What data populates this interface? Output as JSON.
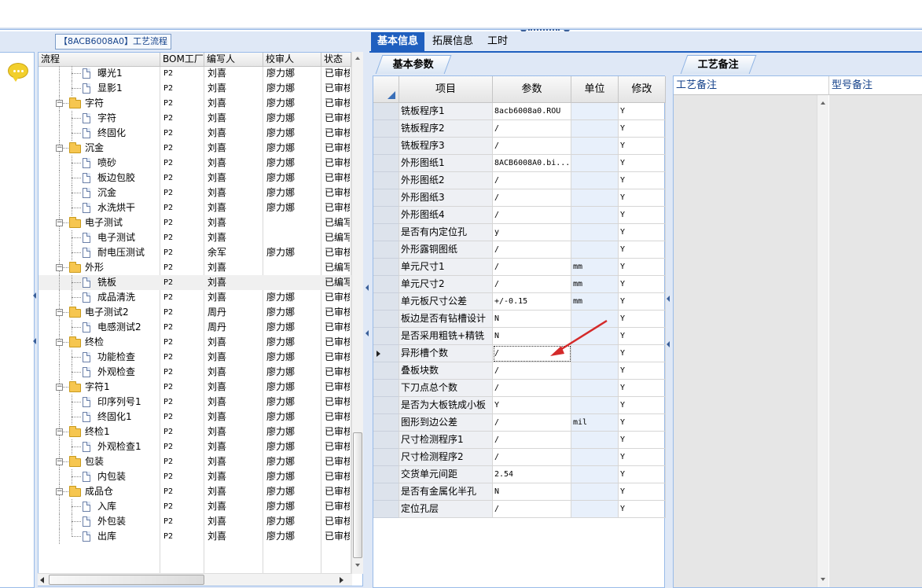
{
  "process_panel": {
    "title": "【8ACB6008A0】工艺流程",
    "columns": [
      "流程",
      "BOM工厂",
      "编写人",
      "校审人",
      "状态"
    ],
    "rows": [
      {
        "level": 2,
        "kind": "doc",
        "name": "曝光1",
        "bom": "P2",
        "author": "刘喜",
        "reviewer": "廖力娜",
        "status": "已审核"
      },
      {
        "level": 2,
        "kind": "doc",
        "name": "显影1",
        "bom": "P2",
        "author": "刘喜",
        "reviewer": "廖力娜",
        "status": "已审核"
      },
      {
        "level": 1,
        "kind": "folder",
        "name": "字符",
        "bom": "P2",
        "author": "刘喜",
        "reviewer": "廖力娜",
        "status": "已审核"
      },
      {
        "level": 2,
        "kind": "doc",
        "name": "字符",
        "bom": "P2",
        "author": "刘喜",
        "reviewer": "廖力娜",
        "status": "已审核"
      },
      {
        "level": 2,
        "kind": "doc",
        "name": "终固化",
        "bom": "P2",
        "author": "刘喜",
        "reviewer": "廖力娜",
        "status": "已审核"
      },
      {
        "level": 1,
        "kind": "folder",
        "name": "沉金",
        "bom": "P2",
        "author": "刘喜",
        "reviewer": "廖力娜",
        "status": "已审核"
      },
      {
        "level": 2,
        "kind": "doc",
        "name": "喷砂",
        "bom": "P2",
        "author": "刘喜",
        "reviewer": "廖力娜",
        "status": "已审核"
      },
      {
        "level": 2,
        "kind": "doc",
        "name": "板边包胶",
        "bom": "P2",
        "author": "刘喜",
        "reviewer": "廖力娜",
        "status": "已审核"
      },
      {
        "level": 2,
        "kind": "doc",
        "name": "沉金",
        "bom": "P2",
        "author": "刘喜",
        "reviewer": "廖力娜",
        "status": "已审核"
      },
      {
        "level": 2,
        "kind": "doc",
        "name": "水洗烘干",
        "bom": "P2",
        "author": "刘喜",
        "reviewer": "廖力娜",
        "status": "已审核"
      },
      {
        "level": 1,
        "kind": "folder",
        "name": "电子测试",
        "bom": "P2",
        "author": "刘喜",
        "reviewer": "",
        "status": "已编写"
      },
      {
        "level": 2,
        "kind": "doc",
        "name": "电子测试",
        "bom": "P2",
        "author": "刘喜",
        "reviewer": "",
        "status": "已编写"
      },
      {
        "level": 2,
        "kind": "doc",
        "name": "耐电压测试",
        "bom": "P2",
        "author": "余军",
        "reviewer": "廖力娜",
        "status": "已审核"
      },
      {
        "level": 1,
        "kind": "folder",
        "name": "外形",
        "bom": "P2",
        "author": "刘喜",
        "reviewer": "",
        "status": "已编写"
      },
      {
        "level": 2,
        "kind": "doc",
        "name": "铣板",
        "bom": "P2",
        "author": "刘喜",
        "reviewer": "",
        "status": "已编写",
        "selected": true
      },
      {
        "level": 2,
        "kind": "doc",
        "name": "成品清洗",
        "bom": "P2",
        "author": "刘喜",
        "reviewer": "廖力娜",
        "status": "已审核"
      },
      {
        "level": 1,
        "kind": "folder",
        "name": "电子测试2",
        "bom": "P2",
        "author": "周丹",
        "reviewer": "廖力娜",
        "status": "已审核"
      },
      {
        "level": 2,
        "kind": "doc",
        "name": "电感测试2",
        "bom": "P2",
        "author": "周丹",
        "reviewer": "廖力娜",
        "status": "已审核"
      },
      {
        "level": 1,
        "kind": "folder",
        "name": "终检",
        "bom": "P2",
        "author": "刘喜",
        "reviewer": "廖力娜",
        "status": "已审核"
      },
      {
        "level": 2,
        "kind": "doc",
        "name": "功能检查",
        "bom": "P2",
        "author": "刘喜",
        "reviewer": "廖力娜",
        "status": "已审核"
      },
      {
        "level": 2,
        "kind": "doc",
        "name": "外观检查",
        "bom": "P2",
        "author": "刘喜",
        "reviewer": "廖力娜",
        "status": "已审核"
      },
      {
        "level": 1,
        "kind": "folder",
        "name": "字符1",
        "bom": "P2",
        "author": "刘喜",
        "reviewer": "廖力娜",
        "status": "已审核"
      },
      {
        "level": 2,
        "kind": "doc",
        "name": "印序列号1",
        "bom": "P2",
        "author": "刘喜",
        "reviewer": "廖力娜",
        "status": "已审核"
      },
      {
        "level": 2,
        "kind": "doc",
        "name": "终固化1",
        "bom": "P2",
        "author": "刘喜",
        "reviewer": "廖力娜",
        "status": "已审核"
      },
      {
        "level": 1,
        "kind": "folder",
        "name": "终检1",
        "bom": "P2",
        "author": "刘喜",
        "reviewer": "廖力娜",
        "status": "已审核"
      },
      {
        "level": 2,
        "kind": "doc",
        "name": "外观检查1",
        "bom": "P2",
        "author": "刘喜",
        "reviewer": "廖力娜",
        "status": "已审核"
      },
      {
        "level": 1,
        "kind": "folder",
        "name": "包装",
        "bom": "P2",
        "author": "刘喜",
        "reviewer": "廖力娜",
        "status": "已审核"
      },
      {
        "level": 2,
        "kind": "doc",
        "name": "内包装",
        "bom": "P2",
        "author": "刘喜",
        "reviewer": "廖力娜",
        "status": "已审核"
      },
      {
        "level": 1,
        "kind": "folder",
        "name": "成品仓",
        "bom": "P2",
        "author": "刘喜",
        "reviewer": "廖力娜",
        "status": "已审核"
      },
      {
        "level": 2,
        "kind": "doc",
        "name": "入库",
        "bom": "P2",
        "author": "刘喜",
        "reviewer": "廖力娜",
        "status": "已审核"
      },
      {
        "level": 2,
        "kind": "doc",
        "name": "外包装",
        "bom": "P2",
        "author": "刘喜",
        "reviewer": "廖力娜",
        "status": "已审核"
      },
      {
        "level": 2,
        "kind": "doc",
        "name": "出库",
        "bom": "P2",
        "author": "刘喜",
        "reviewer": "廖力娜",
        "status": "已审核"
      }
    ]
  },
  "tabs": [
    "基本信息",
    "拓展信息",
    "工时"
  ],
  "active_tab": 0,
  "param_tab": "基本参数",
  "remark_tab": "工艺备注",
  "param_grid": {
    "columns": [
      "项目",
      "参数",
      "单位",
      "修改"
    ],
    "current_row": 14,
    "rows": [
      {
        "item": "铣板程序1",
        "param": "8acb6008a0.ROU",
        "unit": "",
        "mod": "Y"
      },
      {
        "item": "铣板程序2",
        "param": "/",
        "unit": "",
        "mod": "Y"
      },
      {
        "item": "铣板程序3",
        "param": "/",
        "unit": "",
        "mod": "Y"
      },
      {
        "item": "外形图纸1",
        "param": "8ACB6008A0.bi...",
        "unit": "",
        "mod": "Y"
      },
      {
        "item": "外形图纸2",
        "param": "/",
        "unit": "",
        "mod": "Y"
      },
      {
        "item": "外形图纸3",
        "param": "/",
        "unit": "",
        "mod": "Y"
      },
      {
        "item": "外形图纸4",
        "param": "/",
        "unit": "",
        "mod": "Y"
      },
      {
        "item": "是否有内定位孔",
        "param": "y",
        "unit": "",
        "mod": "Y"
      },
      {
        "item": "外形露铜图纸",
        "param": "/",
        "unit": "",
        "mod": "Y"
      },
      {
        "item": "单元尺寸1",
        "param": "/",
        "unit": "mm",
        "mod": "Y"
      },
      {
        "item": "单元尺寸2",
        "param": "/",
        "unit": "mm",
        "mod": "Y"
      },
      {
        "item": "单元板尺寸公差",
        "param": "+/-0.15",
        "unit": "mm",
        "mod": "Y"
      },
      {
        "item": "板边是否有钻槽设计",
        "param": "N",
        "unit": "",
        "mod": "Y"
      },
      {
        "item": "是否采用粗铣+精铣",
        "param": "N",
        "unit": "",
        "mod": "Y"
      },
      {
        "item": "异形槽个数",
        "param": "/",
        "unit": "",
        "mod": "Y"
      },
      {
        "item": "叠板块数",
        "param": "/",
        "unit": "",
        "mod": "Y"
      },
      {
        "item": "下刀点总个数",
        "param": "/",
        "unit": "",
        "mod": "Y"
      },
      {
        "item": "是否为大板铣成小板",
        "param": "Y",
        "unit": "",
        "mod": "Y"
      },
      {
        "item": "图形到边公差",
        "param": "/",
        "unit": "mil",
        "mod": "Y"
      },
      {
        "item": "尺寸检测程序1",
        "param": "/",
        "unit": "",
        "mod": "Y"
      },
      {
        "item": "尺寸检测程序2",
        "param": "/",
        "unit": "",
        "mod": "Y"
      },
      {
        "item": "交货单元间距",
        "param": "2.54",
        "unit": "",
        "mod": "Y"
      },
      {
        "item": "是否有金属化半孔",
        "param": "N",
        "unit": "",
        "mod": "Y"
      },
      {
        "item": "定位孔层",
        "param": "/",
        "unit": "",
        "mod": "Y"
      }
    ]
  },
  "remark_grid": {
    "columns": [
      "工艺备注",
      "型号备注"
    ]
  },
  "colors": {
    "accent": "#1f5fbf",
    "frame": "#dfe8f6",
    "annotation_arrow": "#d42a2a"
  }
}
